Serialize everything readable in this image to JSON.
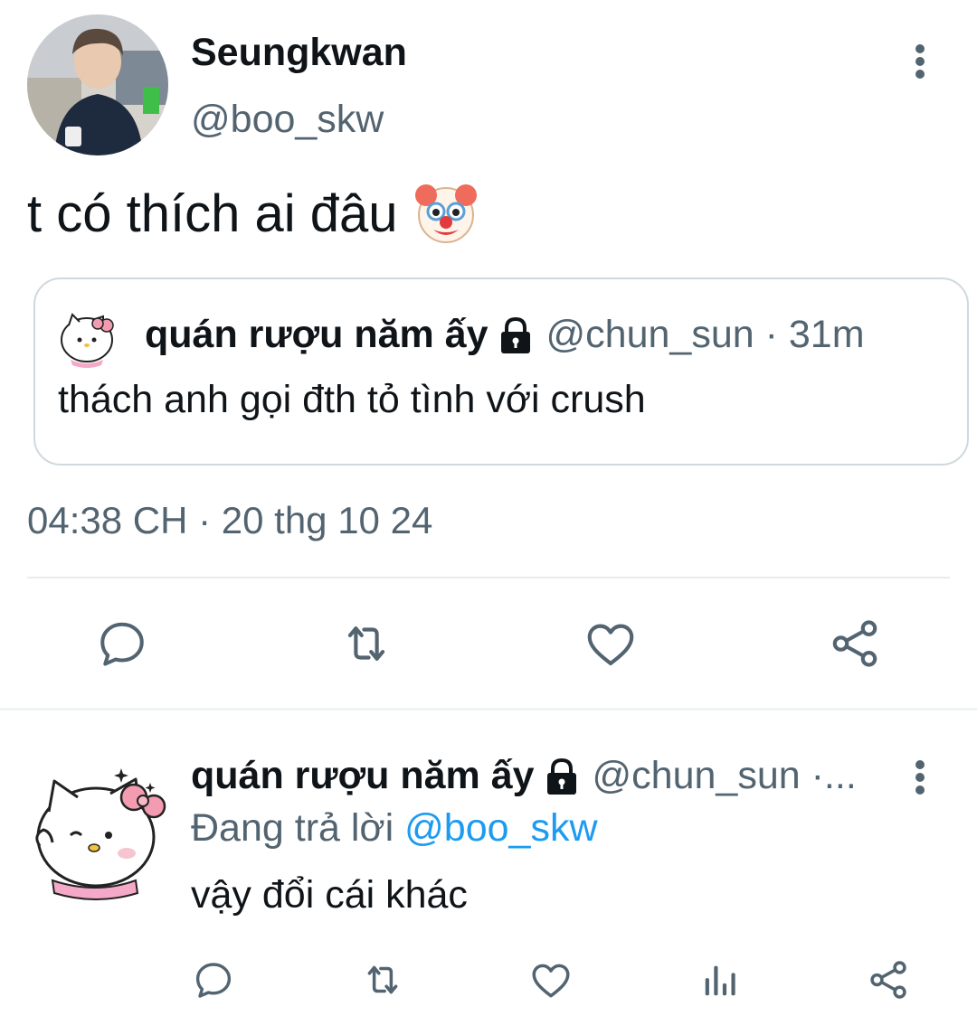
{
  "main_tweet": {
    "author_name": "Seungkwan",
    "author_handle": "@boo_skw",
    "text": "t có thích ai đâu",
    "emoji": "clown-face-emoji",
    "timestamp": "04:38 CH · 20 thg 10 24",
    "quoted_tweet": {
      "author_name": "quán rượu năm ấy",
      "meta": "@chun_sun · 31m",
      "text": "thách anh gọi đth tỏ tình với crush"
    },
    "actions": [
      "reply-icon",
      "retweet-icon",
      "like-icon",
      "share-icon"
    ]
  },
  "reply": {
    "author_name": "quán rượu năm ấy",
    "meta": "@chun_sun ·...",
    "replying_prefix": "Đang trả lời",
    "replying_handle": "@boo_skw",
    "text": "vậy đổi cái khác",
    "actions": [
      "reply-icon",
      "retweet-icon",
      "like-icon",
      "analytics-icon",
      "share-icon"
    ]
  },
  "colors": {
    "text": "#0f1419",
    "secondary": "#536471",
    "link": "#1d9bf0",
    "border": "#cfd9de"
  }
}
